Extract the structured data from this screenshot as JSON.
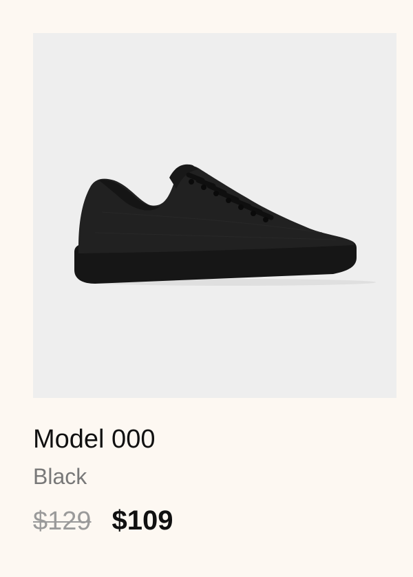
{
  "product": {
    "image_icon": "sneaker-image",
    "name": "Model 000",
    "color": "Black",
    "original_price": "$129",
    "sale_price": "$109"
  },
  "colors": {
    "page_background": "#fdf8f2",
    "image_background": "#eeeeee",
    "shoe": "#1e1e1e",
    "original_price": "#9a9a9a",
    "sale_price": "#111111",
    "color_label": "#787878"
  }
}
